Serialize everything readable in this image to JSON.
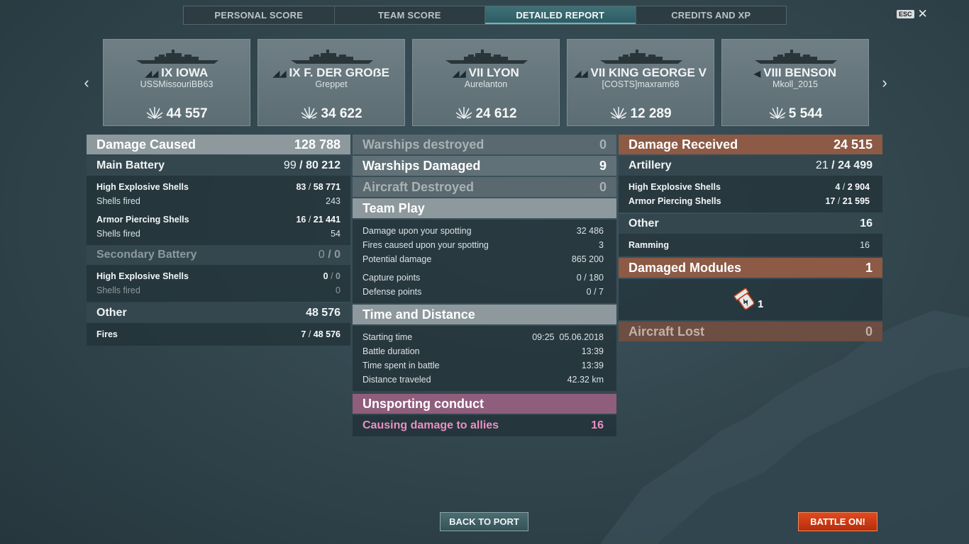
{
  "tabs": [
    {
      "label": "PERSONAL SCORE",
      "active": false
    },
    {
      "label": "TEAM SCORE",
      "active": false
    },
    {
      "label": "DETAILED REPORT",
      "active": true
    },
    {
      "label": "CREDITS AND XP",
      "active": false
    }
  ],
  "esc_label": "ESC",
  "ships": [
    {
      "name": "IX IOWA",
      "player": "USSMissouriBB63",
      "damage": "44 557",
      "class_icon": "battleship-icon"
    },
    {
      "name": "IX F. DER GROẞE",
      "player": "Greppet",
      "damage": "34 622",
      "class_icon": "battleship-icon"
    },
    {
      "name": "VII LYON",
      "player": "Aurelanton",
      "damage": "24 612",
      "class_icon": "battleship-icon"
    },
    {
      "name": "VII KING GEORGE V",
      "player": "[COSTS]maxram68",
      "damage": "12 289",
      "class_icon": "battleship-icon"
    },
    {
      "name": "VIII BENSON",
      "player": "Mkoll_2015",
      "damage": "5 544",
      "class_icon": "destroyer-icon"
    }
  ],
  "left": {
    "damage_caused": {
      "label": "Damage Caused",
      "value": "128 788"
    },
    "main_battery": {
      "label": "Main Battery",
      "hits": "99",
      "damage": "80 212"
    },
    "mb_he": {
      "label": "High Explosive Shells",
      "hits": "83",
      "damage": "58 771"
    },
    "mb_he_fired": {
      "label": "Shells fired",
      "value": "243"
    },
    "mb_ap": {
      "label": "Armor Piercing Shells",
      "hits": "16",
      "damage": "21 441"
    },
    "mb_ap_fired": {
      "label": "Shells fired",
      "value": "54"
    },
    "secondary": {
      "label": "Secondary Battery",
      "hits": "0",
      "damage": "0"
    },
    "sec_he": {
      "label": "High Explosive Shells",
      "hits": "0",
      "damage": "0"
    },
    "sec_fired": {
      "label": "Shells fired",
      "value": "0"
    },
    "other": {
      "label": "Other",
      "value": "48 576"
    },
    "fires": {
      "label": "Fires",
      "hits": "7",
      "damage": "48 576"
    }
  },
  "middle": {
    "warships_destroyed": {
      "label": "Warships destroyed",
      "value": "0"
    },
    "warships_damaged": {
      "label": "Warships Damaged",
      "value": "9"
    },
    "aircraft_destroyed": {
      "label": "Aircraft Destroyed",
      "value": "0"
    },
    "team_play": {
      "label": "Team Play"
    },
    "spotting_damage": {
      "label": "Damage upon your spotting",
      "value": "32 486"
    },
    "spotting_fires": {
      "label": "Fires caused upon your spotting",
      "value": "3"
    },
    "potential": {
      "label": "Potential damage",
      "value": "865 200"
    },
    "capture": {
      "label": "Capture points",
      "value": "0 / 180"
    },
    "defense": {
      "label": "Defense points",
      "value": "0 / 7"
    },
    "time_distance": {
      "label": "Time and Distance"
    },
    "start_time": {
      "label": "Starting time",
      "value": "09:25  05.06.2018"
    },
    "duration": {
      "label": "Battle duration",
      "value": "13:39"
    },
    "time_spent": {
      "label": "Time spent in battle",
      "value": "13:39"
    },
    "distance": {
      "label": "Distance traveled",
      "value": "42.32 km"
    },
    "unsporting": {
      "label": "Unsporting conduct"
    },
    "ally_damage": {
      "label": "Causing damage to allies",
      "value": "16"
    }
  },
  "right": {
    "damage_received": {
      "label": "Damage Received",
      "value": "24 515"
    },
    "artillery": {
      "label": "Artillery",
      "hits": "21",
      "damage": "24 499"
    },
    "he": {
      "label": "High Explosive Shells",
      "hits": "4",
      "damage": "2 904"
    },
    "ap": {
      "label": "Armor Piercing Shells",
      "hits": "17",
      "damage": "21 595"
    },
    "other": {
      "label": "Other",
      "value": "16"
    },
    "ramming": {
      "label": "Ramming",
      "value": "16"
    },
    "modules": {
      "label": "Damaged Modules",
      "value": "1",
      "count": "1"
    },
    "aircraft_lost": {
      "label": "Aircraft Lost",
      "value": "0"
    }
  },
  "buttons": {
    "back": "BACK TO PORT",
    "battle": "BATTLE ON!"
  },
  "colors": {
    "accent_tab": "#3f7078",
    "received": "#8c5a45",
    "unsporting": "#8f5e7c",
    "battle_button": "#d03d16"
  }
}
